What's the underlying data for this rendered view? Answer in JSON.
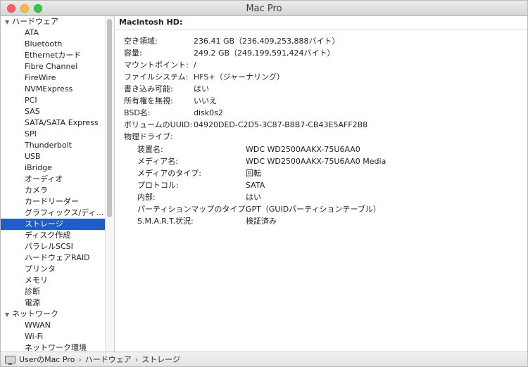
{
  "window": {
    "title": "Mac Pro"
  },
  "sidebar": {
    "categories": [
      {
        "label": "ハードウェア",
        "expanded": true,
        "items": [
          "ATA",
          "Bluetooth",
          "Ethernetカード",
          "Fibre Channel",
          "FireWire",
          "NVMExpress",
          "PCI",
          "SAS",
          "SATA/SATA Express",
          "SPI",
          "Thunderbolt",
          "USB",
          "iBridge",
          "オーディオ",
          "カメラ",
          "カードリーダー",
          "グラフィックス/ディ…",
          "ストレージ",
          "ディスク作成",
          "パラレルSCSI",
          "ハードウェアRAID",
          "プリンタ",
          "メモリ",
          "診断",
          "電源"
        ]
      },
      {
        "label": "ネットワーク",
        "expanded": true,
        "items": [
          "WWAN",
          "Wi-Fi",
          "ネットワーク環境"
        ]
      }
    ],
    "selected": "ストレージ"
  },
  "content": {
    "title": "Macintosh HD:",
    "properties": [
      {
        "label": "空き領域:",
        "value": "236.41 GB（236,409,253,888バイト）"
      },
      {
        "label": "容量:",
        "value": "249.2 GB（249,199,591,424バイト）"
      },
      {
        "label": "マウントポイント:",
        "value": "/"
      },
      {
        "label": "ファイルシステム:",
        "value": "HFS+（ジャーナリング）"
      },
      {
        "label": "書き込み可能:",
        "value": "はい"
      },
      {
        "label": "所有権を無視:",
        "value": "いいえ"
      },
      {
        "label": "BSD名:",
        "value": "disk0s2"
      },
      {
        "label": "ボリュームのUUID:",
        "value": "04920DED-C2D5-3C87-B8B7-CB43E5AFF2B8"
      },
      {
        "label": "物理ドライブ:",
        "value": ""
      }
    ],
    "drive_properties": [
      {
        "label": "装置名:",
        "value": "WDC WD2500AAKX-75U6AA0"
      },
      {
        "label": "メディア名:",
        "value": "WDC WD2500AAKX-75U6AA0 Media"
      },
      {
        "label": "メディアのタイプ:",
        "value": "回転"
      },
      {
        "label": "プロトコル:",
        "value": "SATA"
      },
      {
        "label": "内部:",
        "value": "はい"
      },
      {
        "label": "パーティションマップのタイプ:",
        "value": "GPT（GUIDパーティションテーブル）"
      },
      {
        "label": "S.M.A.R.T.状況:",
        "value": "検証済み"
      }
    ]
  },
  "statusbar": {
    "breadcrumb": [
      "UserのMac Pro",
      "ハードウェア",
      "ストレージ"
    ],
    "separator": "›"
  },
  "colors": {
    "selection": "#1f5ec9",
    "close": "#fc605c",
    "minimize": "#fdbc40",
    "zoom": "#34c84a"
  },
  "icons": {
    "disclosure_expanded": "disclosure-triangle-down-icon",
    "computer": "mac-computer-icon"
  }
}
